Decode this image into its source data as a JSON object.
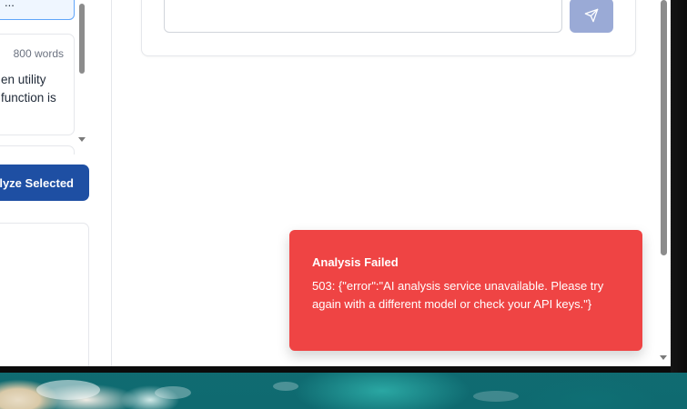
{
  "sidebar": {
    "top_chip_text": "...",
    "document_card": {
      "word_count": "800 words",
      "preview_text": "en utility\nfunction is"
    },
    "analyze_button_label": "lyze Selected"
  },
  "chat": {
    "input_value": "",
    "send_icon": "send-icon"
  },
  "toast": {
    "title": "Analysis Failed",
    "message": "503: {\"error\":\"AI analysis service unavailable. Please try again with a different model or check your API keys.\"}"
  },
  "colors": {
    "toast_bg": "#ef4444",
    "primary_button": "#1e4fa3",
    "send_button": "#9aaad6",
    "selected_border": "#60a5fa"
  }
}
